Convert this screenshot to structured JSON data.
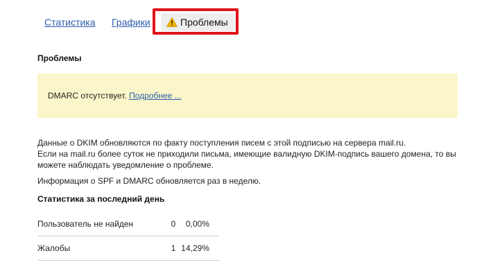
{
  "tabs": {
    "stats_label": "Статистика",
    "graphs_label": "Графики",
    "problems_label": "Проблемы",
    "problems_icon": "warning-icon"
  },
  "section_title": "Проблемы",
  "alert": {
    "text": "DMARC отсутствует.",
    "link_label": "Подробнее ..."
  },
  "info": {
    "line1": "Данные о DKIM обновляются по факту поступления писем с этой подписью на сервера mail.ru.",
    "line2": "Если на mail.ru более суток не приходили письма, имеющие валидную DKIM-подпись вашего домена, то вы",
    "line3": "можете наблюдать уведомление о проблеме.",
    "spf": "Информация о SPF и DMARC обновляется раз в неделю."
  },
  "stats": {
    "title": "Статистика за последний день",
    "rows": [
      {
        "label": "Пользователь не найден",
        "count": "0",
        "percent": "0,00%"
      },
      {
        "label": "Жалобы",
        "count": "1",
        "percent": "14,29%"
      }
    ]
  },
  "colors": {
    "link": "#2a5caa",
    "highlight": "#e0141b",
    "alert_bg": "#fbf6c9",
    "warning_icon": "#f0b400"
  }
}
